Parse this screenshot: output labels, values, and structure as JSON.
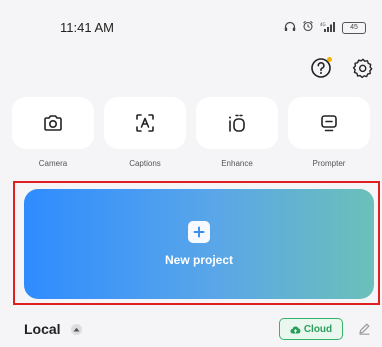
{
  "status_bar": {
    "time": "11:41 AM",
    "battery": "45"
  },
  "tools": [
    {
      "label": "Camera",
      "icon": "camera-icon"
    },
    {
      "label": "Captions",
      "icon": "captions-icon"
    },
    {
      "label": "Enhance",
      "icon": "enhance-icon"
    },
    {
      "label": "Prompter",
      "icon": "prompter-icon"
    }
  ],
  "new_project": {
    "label": "New project"
  },
  "bottom": {
    "local_label": "Local",
    "cloud_label": "Cloud"
  },
  "colors": {
    "accent_green": "#34b36b",
    "gradient_start": "#2f8cff",
    "gradient_end": "#6cc0b8",
    "highlight_red": "#e02020",
    "notif_dot": "#f5b400"
  }
}
